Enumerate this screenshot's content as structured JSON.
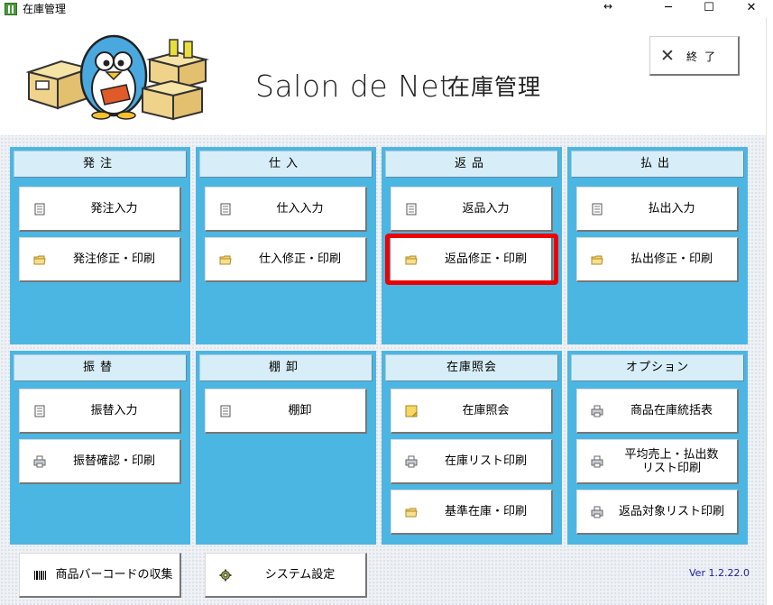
{
  "window": {
    "title": "在庫管理",
    "resize_glyph": "↔",
    "minimize_glyph": "─",
    "maximize_glyph": "☐",
    "close_glyph": "✕"
  },
  "header": {
    "app_name": "Salon de Net",
    "app_name_jp": "在庫管理",
    "exit_label": "終了",
    "exit_glyph": "✕"
  },
  "panels": [
    {
      "title": "発注",
      "buttons": [
        {
          "label": "発注入力",
          "icon": "document-icon"
        },
        {
          "label": "発注修正・印刷",
          "icon": "folder-icon"
        }
      ]
    },
    {
      "title": "仕入",
      "buttons": [
        {
          "label": "仕入入力",
          "icon": "document-icon"
        },
        {
          "label": "仕入修正・印刷",
          "icon": "folder-icon"
        }
      ]
    },
    {
      "title": "返品",
      "buttons": [
        {
          "label": "返品入力",
          "icon": "document-icon"
        },
        {
          "label": "返品修正・印刷",
          "icon": "folder-icon"
        }
      ]
    },
    {
      "title": "払出",
      "buttons": [
        {
          "label": "払出入力",
          "icon": "document-icon"
        },
        {
          "label": "払出修正・印刷",
          "icon": "folder-icon"
        }
      ]
    },
    {
      "title": "振替",
      "buttons": [
        {
          "label": "振替入力",
          "icon": "document-icon"
        },
        {
          "label": "振替確認・印刷",
          "icon": "printer-icon"
        }
      ]
    },
    {
      "title": "棚卸",
      "buttons": [
        {
          "label": "棚卸",
          "icon": "document-icon"
        }
      ]
    },
    {
      "title": "在庫照会",
      "buttons": [
        {
          "label": "在庫照会",
          "icon": "note-icon"
        },
        {
          "label": "在庫リスト印刷",
          "icon": "printer-icon"
        },
        {
          "label": "基準在庫・印刷",
          "icon": "folder-icon"
        }
      ]
    },
    {
      "title": "オプション",
      "buttons": [
        {
          "label": "商品在庫統括表",
          "icon": "printer-icon"
        },
        {
          "label": "平均売上・払出数\nリスト印刷",
          "icon": "printer-icon"
        },
        {
          "label": "返品対象リスト印刷",
          "icon": "printer-icon"
        }
      ]
    }
  ],
  "footer": {
    "barcode_label": "商品バーコードの収集",
    "settings_label": "システム設定",
    "version": "Ver 1.2.22.0"
  },
  "colors": {
    "panel": "#4cb6e3",
    "panel_header": "#d7eef8",
    "highlight": "#ee0000",
    "version_text": "#2020a0"
  }
}
